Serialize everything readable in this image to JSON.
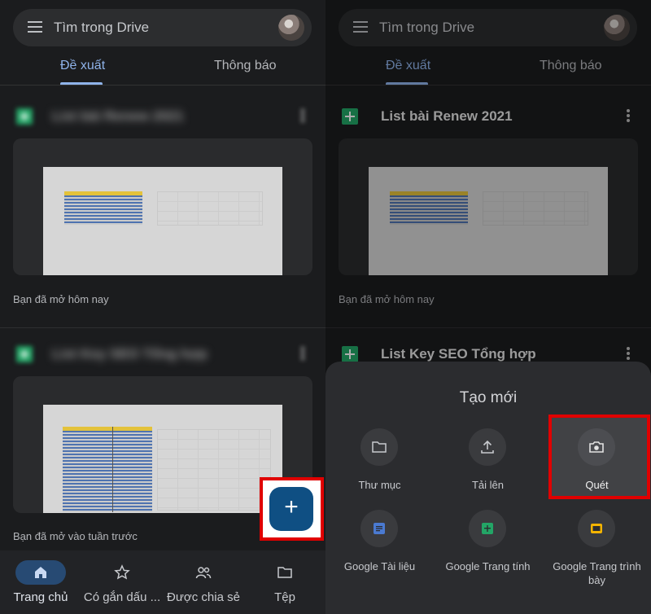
{
  "left": {
    "search_placeholder": "Tìm trong Drive",
    "tabs": [
      "Đề xuất",
      "Thông báo"
    ],
    "files": [
      {
        "title": "List bài Renew 2021",
        "opened": "Bạn đã mở hôm nay"
      },
      {
        "title": "List Key SEO Tổng hợp",
        "opened": "Bạn đã mở vào tuần trước"
      }
    ],
    "fab_label": "+",
    "nav": [
      {
        "label": "Trang chủ",
        "icon": "home-icon"
      },
      {
        "label": "Có gắn dấu ...",
        "icon": "star-icon"
      },
      {
        "label": "Được chia sẻ",
        "icon": "people-icon"
      },
      {
        "label": "Tệp",
        "icon": "folder-icon"
      }
    ]
  },
  "right": {
    "search_placeholder": "Tìm trong Drive",
    "tabs": [
      "Đề xuất",
      "Thông báo"
    ],
    "files": [
      {
        "title": "List bài Renew 2021",
        "opened": "Bạn đã mở hôm nay"
      },
      {
        "title": "List Key SEO Tổng hợp"
      }
    ],
    "sheet_title": "Tạo mới",
    "actions": [
      {
        "label": "Thư mục",
        "icon": "folder-icon"
      },
      {
        "label": "Tải lên",
        "icon": "upload-icon"
      },
      {
        "label": "Quét",
        "icon": "camera-icon"
      },
      {
        "label": "Google Tài liệu",
        "icon": "docs-icon"
      },
      {
        "label": "Google Trang tính",
        "icon": "sheets-icon"
      },
      {
        "label": "Google Trang trình bày",
        "icon": "slides-icon"
      }
    ]
  },
  "colors": {
    "accent": "#8fb3ea",
    "highlight": "#e00000",
    "fab": "#0f4f83",
    "sheets_green": "#23a566",
    "slides_yellow": "#f4b400",
    "docs_blue": "#4a7ad1"
  }
}
